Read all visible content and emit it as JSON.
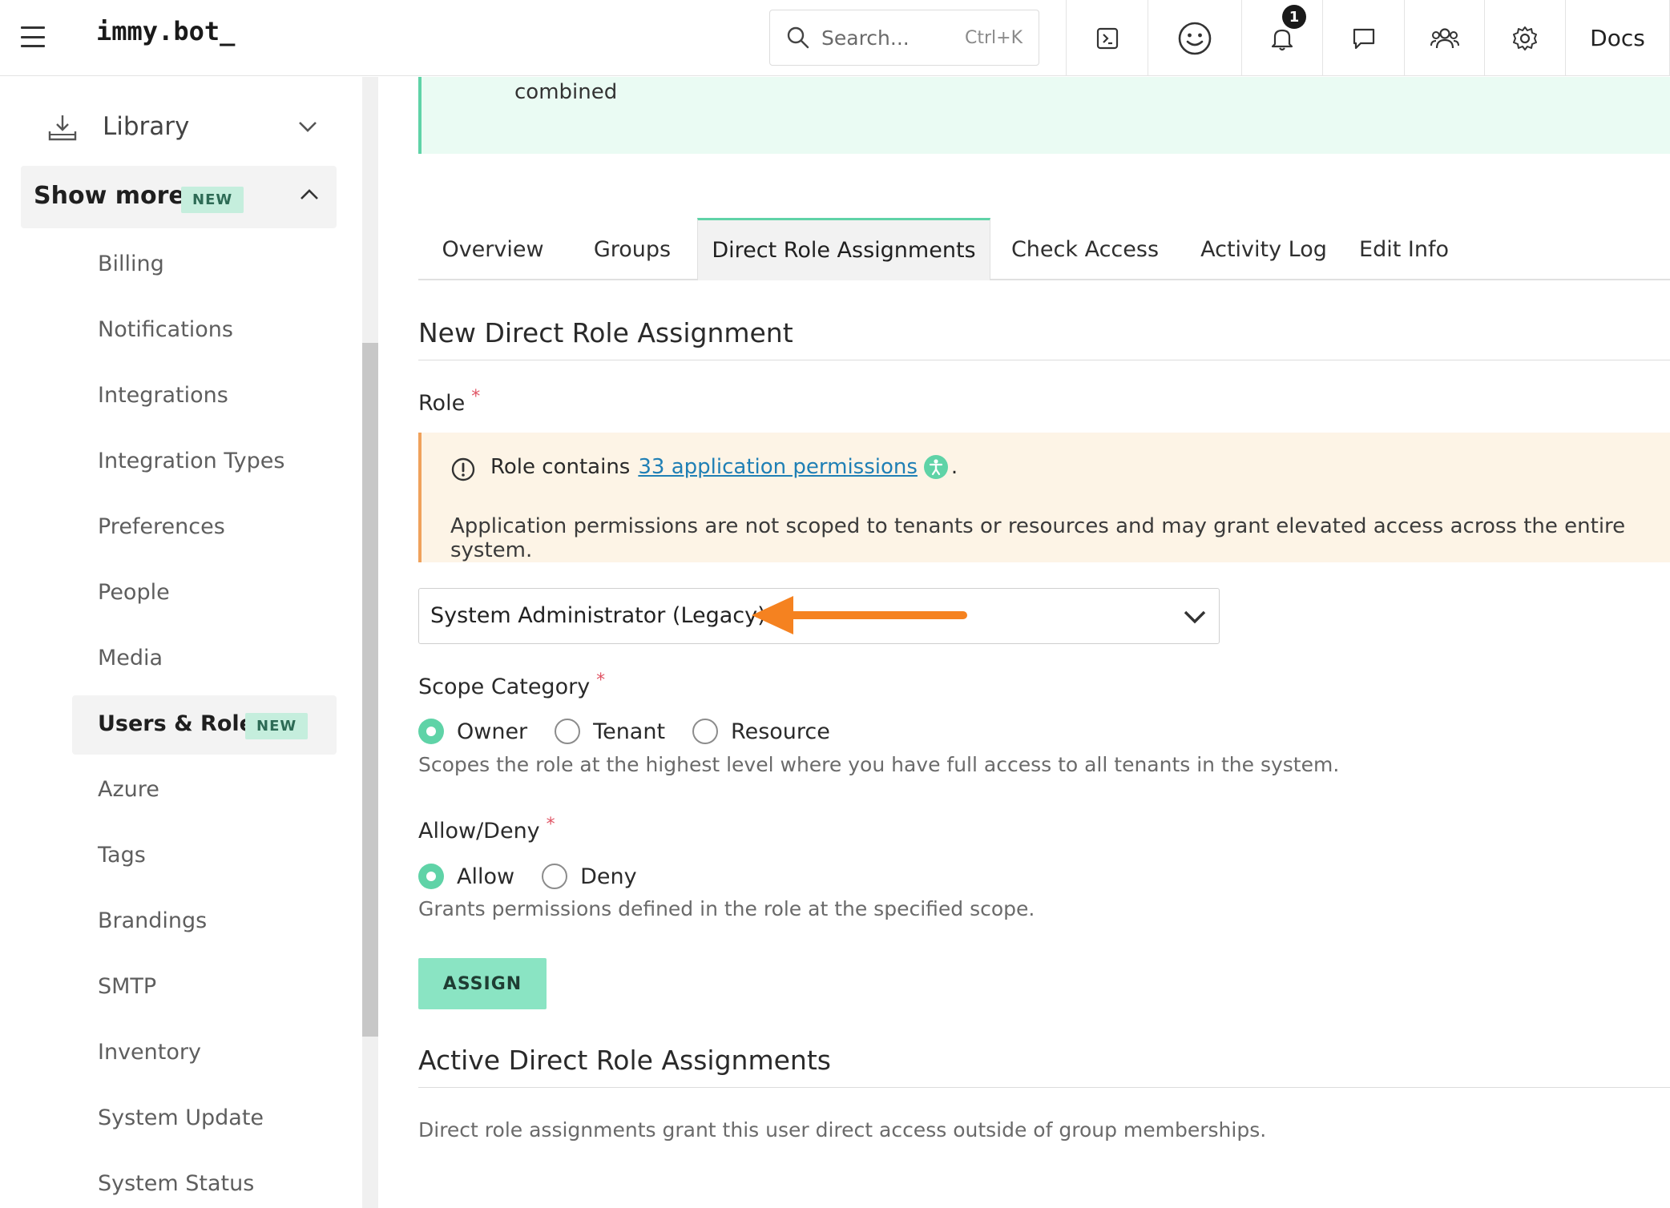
{
  "header": {
    "brand": "immy.bot_",
    "search": {
      "placeholder": "Search...",
      "shortcut": "Ctrl+K"
    },
    "notification_count": "1",
    "docs_label": "Docs",
    "icons": [
      "terminal-icon",
      "smiley-icon",
      "bell-icon",
      "chat-icon",
      "users-icon",
      "gear-icon"
    ]
  },
  "sidebar": {
    "library_label": "Library",
    "show_more": {
      "label": "Show more",
      "badge": "NEW"
    },
    "items": [
      {
        "label": "Billing"
      },
      {
        "label": "Notifications"
      },
      {
        "label": "Integrations"
      },
      {
        "label": "Integration Types"
      },
      {
        "label": "Preferences"
      },
      {
        "label": "People"
      },
      {
        "label": "Media"
      },
      {
        "label": "Users & Roles",
        "badge": "NEW",
        "active": true
      },
      {
        "label": "Azure"
      },
      {
        "label": "Tags"
      },
      {
        "label": "Brandings"
      },
      {
        "label": "SMTP"
      },
      {
        "label": "Inventory"
      },
      {
        "label": "System Update"
      },
      {
        "label": "System Status"
      }
    ]
  },
  "main": {
    "banner_text": "combined",
    "tabs": [
      {
        "label": "Overview"
      },
      {
        "label": "Groups"
      },
      {
        "label": "Direct Role Assignments",
        "active": true
      },
      {
        "label": "Check Access"
      },
      {
        "label": "Activity Log"
      },
      {
        "label": "Edit Info"
      }
    ],
    "new_assignment": {
      "title": "New Direct Role Assignment",
      "role_label": "Role",
      "required_mark": "*",
      "warning": {
        "prefix": "Role contains",
        "link": "33 application permissions",
        "suffix": ".",
        "detail": "Application permissions are not scoped to tenants or resources and may grant elevated access across the entire system."
      },
      "role_value": "System Administrator (Legacy)",
      "scope_label": "Scope Category",
      "scope_options": [
        {
          "label": "Owner",
          "checked": true
        },
        {
          "label": "Tenant",
          "checked": false
        },
        {
          "label": "Resource",
          "checked": false
        }
      ],
      "scope_help": "Scopes the role at the highest level where you have full access to all tenants in the system.",
      "allow_label": "Allow/Deny",
      "allow_options": [
        {
          "label": "Allow",
          "checked": true
        },
        {
          "label": "Deny",
          "checked": false
        }
      ],
      "allow_help": "Grants permissions defined in the role at the specified scope.",
      "assign_button": "ASSIGN"
    },
    "active_assignments": {
      "title": "Active Direct Role Assignments",
      "description": "Direct role assignments grant this user direct access outside of group memberships."
    }
  },
  "colors": {
    "accent": "#5fd3a7",
    "accent_light": "#8ae4c3",
    "warning_border": "#f0a25c",
    "warning_bg": "#fdf4e6",
    "link": "#1f7fb5",
    "annotation_arrow": "#f58220"
  }
}
